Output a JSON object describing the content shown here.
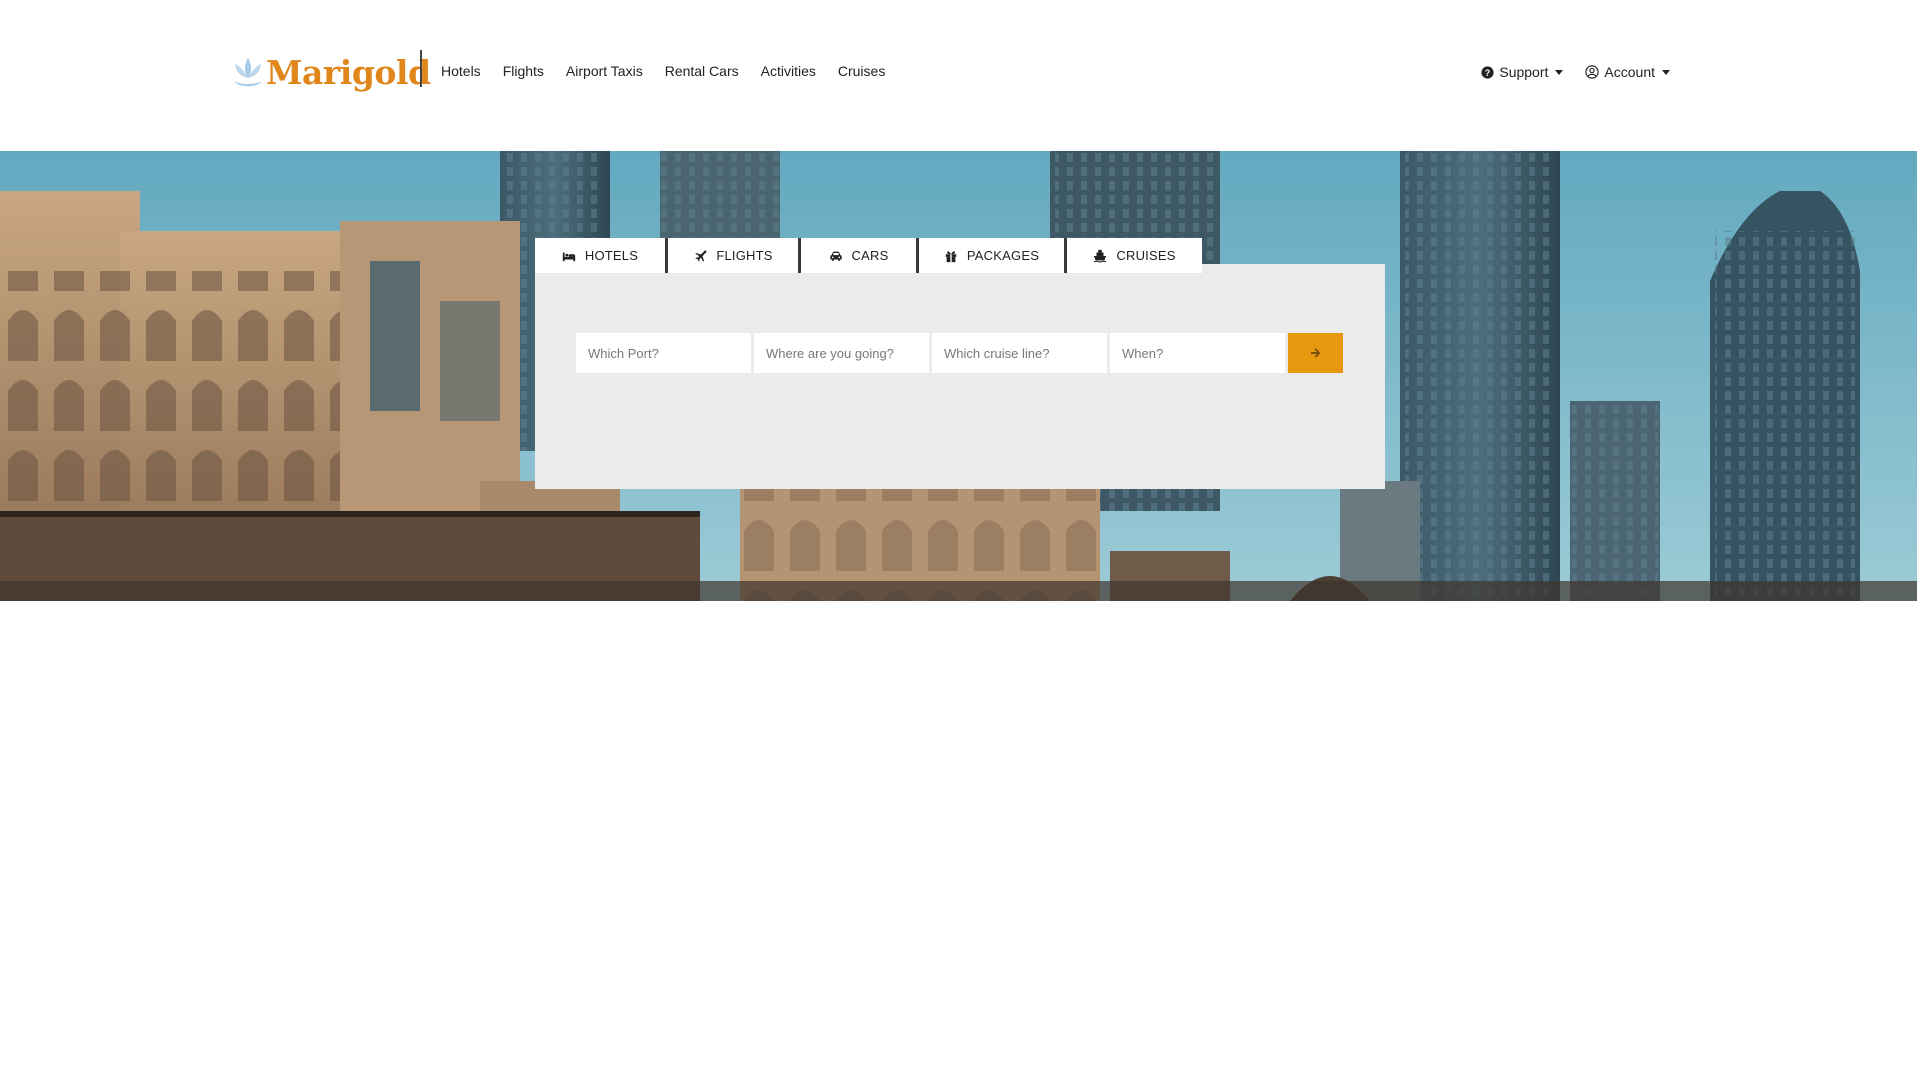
{
  "brand": {
    "name": "Marigold",
    "color": "#e0861a",
    "icon": "lotus-flower-icon"
  },
  "main_nav": [
    {
      "label": "Hotels"
    },
    {
      "label": "Flights"
    },
    {
      "label": "Airport Taxis"
    },
    {
      "label": "Rental Cars"
    },
    {
      "label": "Activities"
    },
    {
      "label": "Cruises"
    }
  ],
  "util_nav": {
    "support": {
      "label": "Support",
      "icon": "question-circle-icon"
    },
    "account": {
      "label": "Account",
      "icon": "user-circle-icon"
    }
  },
  "search": {
    "tabs": [
      {
        "label": "HOTELS",
        "icon": "bed-icon"
      },
      {
        "label": "FLIGHTS",
        "icon": "plane-icon"
      },
      {
        "label": "CARS",
        "icon": "car-icon"
      },
      {
        "label": "PACKAGES",
        "icon": "gift-icon"
      },
      {
        "label": "CRUISES",
        "icon": "ship-icon"
      }
    ],
    "active_tab": "CRUISES",
    "fields": {
      "port": {
        "placeholder": "Which Port?",
        "value": ""
      },
      "destination": {
        "placeholder": "Where are you going?",
        "value": ""
      },
      "cruise_line": {
        "placeholder": "Which cruise line?",
        "value": ""
      },
      "date": {
        "placeholder": "When?",
        "value": ""
      }
    },
    "submit": {
      "icon": "arrow-right-icon",
      "color": "#e8980e"
    }
  },
  "colors": {
    "panel_bg": "#ebebeb",
    "accent": "#e8980e"
  }
}
